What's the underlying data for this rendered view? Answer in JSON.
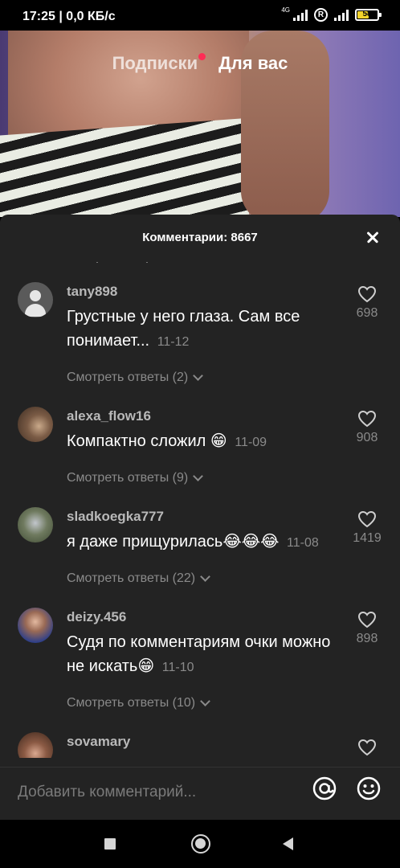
{
  "status_bar": {
    "time_speed": "17:25 | 0,0 КБ/с",
    "network_label": "4G",
    "roaming_label": "R",
    "battery_level": "58"
  },
  "feed_tabs": {
    "following": "Подписки",
    "for_you": "Для вас"
  },
  "comments_sheet": {
    "title": "Комментарии: 8667",
    "comments": [
      {
        "username": "tany898",
        "text": "Грустные у него глаза. Сам все понимает...",
        "date": "11-12",
        "likes": "698",
        "replies": "Смотреть ответы (2)"
      },
      {
        "username": "alexa_flow16",
        "text": "Компактно сложил 😁",
        "date": "11-09",
        "likes": "908",
        "replies": "Смотреть ответы (9)"
      },
      {
        "username": "sladkoegka777",
        "text": "я даже прищурилась😂😂😂",
        "date": "11-08",
        "likes": "1419",
        "replies": "Смотреть ответы (22)"
      },
      {
        "username": "deizy.456",
        "text": "Судя по комментариям очки можно не искать😁",
        "date": "11-10",
        "likes": "898",
        "replies": "Смотреть ответы (10)"
      },
      {
        "username": "sovamary"
      }
    ]
  },
  "input_bar": {
    "placeholder": "Добавить комментарий..."
  },
  "colors": {
    "sheet_bg": "#232323",
    "accent_dot": "#fe2c55",
    "muted_text": "#8a8a8a",
    "battery": "#f2d32b"
  }
}
